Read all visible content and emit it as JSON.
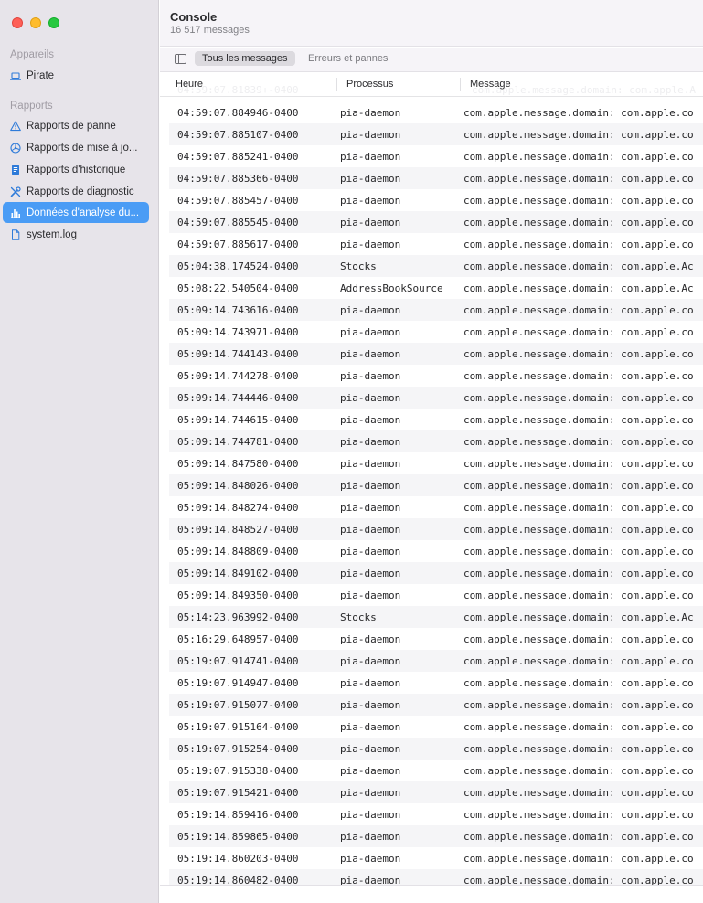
{
  "window": {
    "title": "Console",
    "message_count": "16 517 messages"
  },
  "sidebar": {
    "devices_header": "Appareils",
    "devices": [
      {
        "label": "Pirate",
        "icon": "laptop-icon"
      }
    ],
    "reports_header": "Rapports",
    "reports": [
      {
        "label": "Rapports de panne",
        "icon": "warning-icon",
        "active": false
      },
      {
        "label": "Rapports de mise à jo...",
        "icon": "spin-icon",
        "active": false
      },
      {
        "label": "Rapports d'historique",
        "icon": "document-icon",
        "active": false
      },
      {
        "label": "Rapports de diagnostic",
        "icon": "tools-icon",
        "active": false
      },
      {
        "label": "Données d'analyse du...",
        "icon": "chart-icon",
        "active": true
      },
      {
        "label": "system.log",
        "icon": "file-icon",
        "active": false
      }
    ]
  },
  "filters": {
    "all_messages": "Tous les messages",
    "errors_crashes": "Erreurs et pannes"
  },
  "columns": {
    "time": "Heure",
    "process": "Processus",
    "message": "Message"
  },
  "ghost_row": {
    "time": "04:59:07.81839+-0400",
    "message": "com.apple.message.domain: com.apple.A"
  },
  "rows": [
    {
      "time": "04:59:07.884946-0400",
      "process": "pia-daemon",
      "message": "com.apple.message.domain: com.apple.co"
    },
    {
      "time": "04:59:07.885107-0400",
      "process": "pia-daemon",
      "message": "com.apple.message.domain: com.apple.co"
    },
    {
      "time": "04:59:07.885241-0400",
      "process": "pia-daemon",
      "message": "com.apple.message.domain: com.apple.co"
    },
    {
      "time": "04:59:07.885366-0400",
      "process": "pia-daemon",
      "message": "com.apple.message.domain: com.apple.co"
    },
    {
      "time": "04:59:07.885457-0400",
      "process": "pia-daemon",
      "message": "com.apple.message.domain: com.apple.co"
    },
    {
      "time": "04:59:07.885545-0400",
      "process": "pia-daemon",
      "message": "com.apple.message.domain: com.apple.co"
    },
    {
      "time": "04:59:07.885617-0400",
      "process": "pia-daemon",
      "message": "com.apple.message.domain: com.apple.co"
    },
    {
      "time": "05:04:38.174524-0400",
      "process": "Stocks",
      "message": "com.apple.message.domain: com.apple.Ac"
    },
    {
      "time": "05:08:22.540504-0400",
      "process": "AddressBookSource",
      "message": "com.apple.message.domain: com.apple.Ac"
    },
    {
      "time": "05:09:14.743616-0400",
      "process": "pia-daemon",
      "message": "com.apple.message.domain: com.apple.co"
    },
    {
      "time": "05:09:14.743971-0400",
      "process": "pia-daemon",
      "message": "com.apple.message.domain: com.apple.co"
    },
    {
      "time": "05:09:14.744143-0400",
      "process": "pia-daemon",
      "message": "com.apple.message.domain: com.apple.co"
    },
    {
      "time": "05:09:14.744278-0400",
      "process": "pia-daemon",
      "message": "com.apple.message.domain: com.apple.co"
    },
    {
      "time": "05:09:14.744446-0400",
      "process": "pia-daemon",
      "message": "com.apple.message.domain: com.apple.co"
    },
    {
      "time": "05:09:14.744615-0400",
      "process": "pia-daemon",
      "message": "com.apple.message.domain: com.apple.co"
    },
    {
      "time": "05:09:14.744781-0400",
      "process": "pia-daemon",
      "message": "com.apple.message.domain: com.apple.co"
    },
    {
      "time": "05:09:14.847580-0400",
      "process": "pia-daemon",
      "message": "com.apple.message.domain: com.apple.co"
    },
    {
      "time": "05:09:14.848026-0400",
      "process": "pia-daemon",
      "message": "com.apple.message.domain: com.apple.co"
    },
    {
      "time": "05:09:14.848274-0400",
      "process": "pia-daemon",
      "message": "com.apple.message.domain: com.apple.co"
    },
    {
      "time": "05:09:14.848527-0400",
      "process": "pia-daemon",
      "message": "com.apple.message.domain: com.apple.co"
    },
    {
      "time": "05:09:14.848809-0400",
      "process": "pia-daemon",
      "message": "com.apple.message.domain: com.apple.co"
    },
    {
      "time": "05:09:14.849102-0400",
      "process": "pia-daemon",
      "message": "com.apple.message.domain: com.apple.co"
    },
    {
      "time": "05:09:14.849350-0400",
      "process": "pia-daemon",
      "message": "com.apple.message.domain: com.apple.co"
    },
    {
      "time": "05:14:23.963992-0400",
      "process": "Stocks",
      "message": "com.apple.message.domain: com.apple.Ac"
    },
    {
      "time": "05:16:29.648957-0400",
      "process": "pia-daemon",
      "message": "com.apple.message.domain: com.apple.co"
    },
    {
      "time": "05:19:07.914741-0400",
      "process": "pia-daemon",
      "message": "com.apple.message.domain: com.apple.co"
    },
    {
      "time": "05:19:07.914947-0400",
      "process": "pia-daemon",
      "message": "com.apple.message.domain: com.apple.co"
    },
    {
      "time": "05:19:07.915077-0400",
      "process": "pia-daemon",
      "message": "com.apple.message.domain: com.apple.co"
    },
    {
      "time": "05:19:07.915164-0400",
      "process": "pia-daemon",
      "message": "com.apple.message.domain: com.apple.co"
    },
    {
      "time": "05:19:07.915254-0400",
      "process": "pia-daemon",
      "message": "com.apple.message.domain: com.apple.co"
    },
    {
      "time": "05:19:07.915338-0400",
      "process": "pia-daemon",
      "message": "com.apple.message.domain: com.apple.co"
    },
    {
      "time": "05:19:07.915421-0400",
      "process": "pia-daemon",
      "message": "com.apple.message.domain: com.apple.co"
    },
    {
      "time": "05:19:14.859416-0400",
      "process": "pia-daemon",
      "message": "com.apple.message.domain: com.apple.co"
    },
    {
      "time": "05:19:14.859865-0400",
      "process": "pia-daemon",
      "message": "com.apple.message.domain: com.apple.co"
    },
    {
      "time": "05:19:14.860203-0400",
      "process": "pia-daemon",
      "message": "com.apple.message.domain: com.apple.co"
    },
    {
      "time": "05:19:14.860482-0400",
      "process": "pia-daemon",
      "message": "com.apple.message.domain: com.apple.co"
    }
  ],
  "colors": {
    "sidebar_bg": "#e7e4ea",
    "selection": "#4a9cf5",
    "row_alt": "#f5f5f7"
  }
}
